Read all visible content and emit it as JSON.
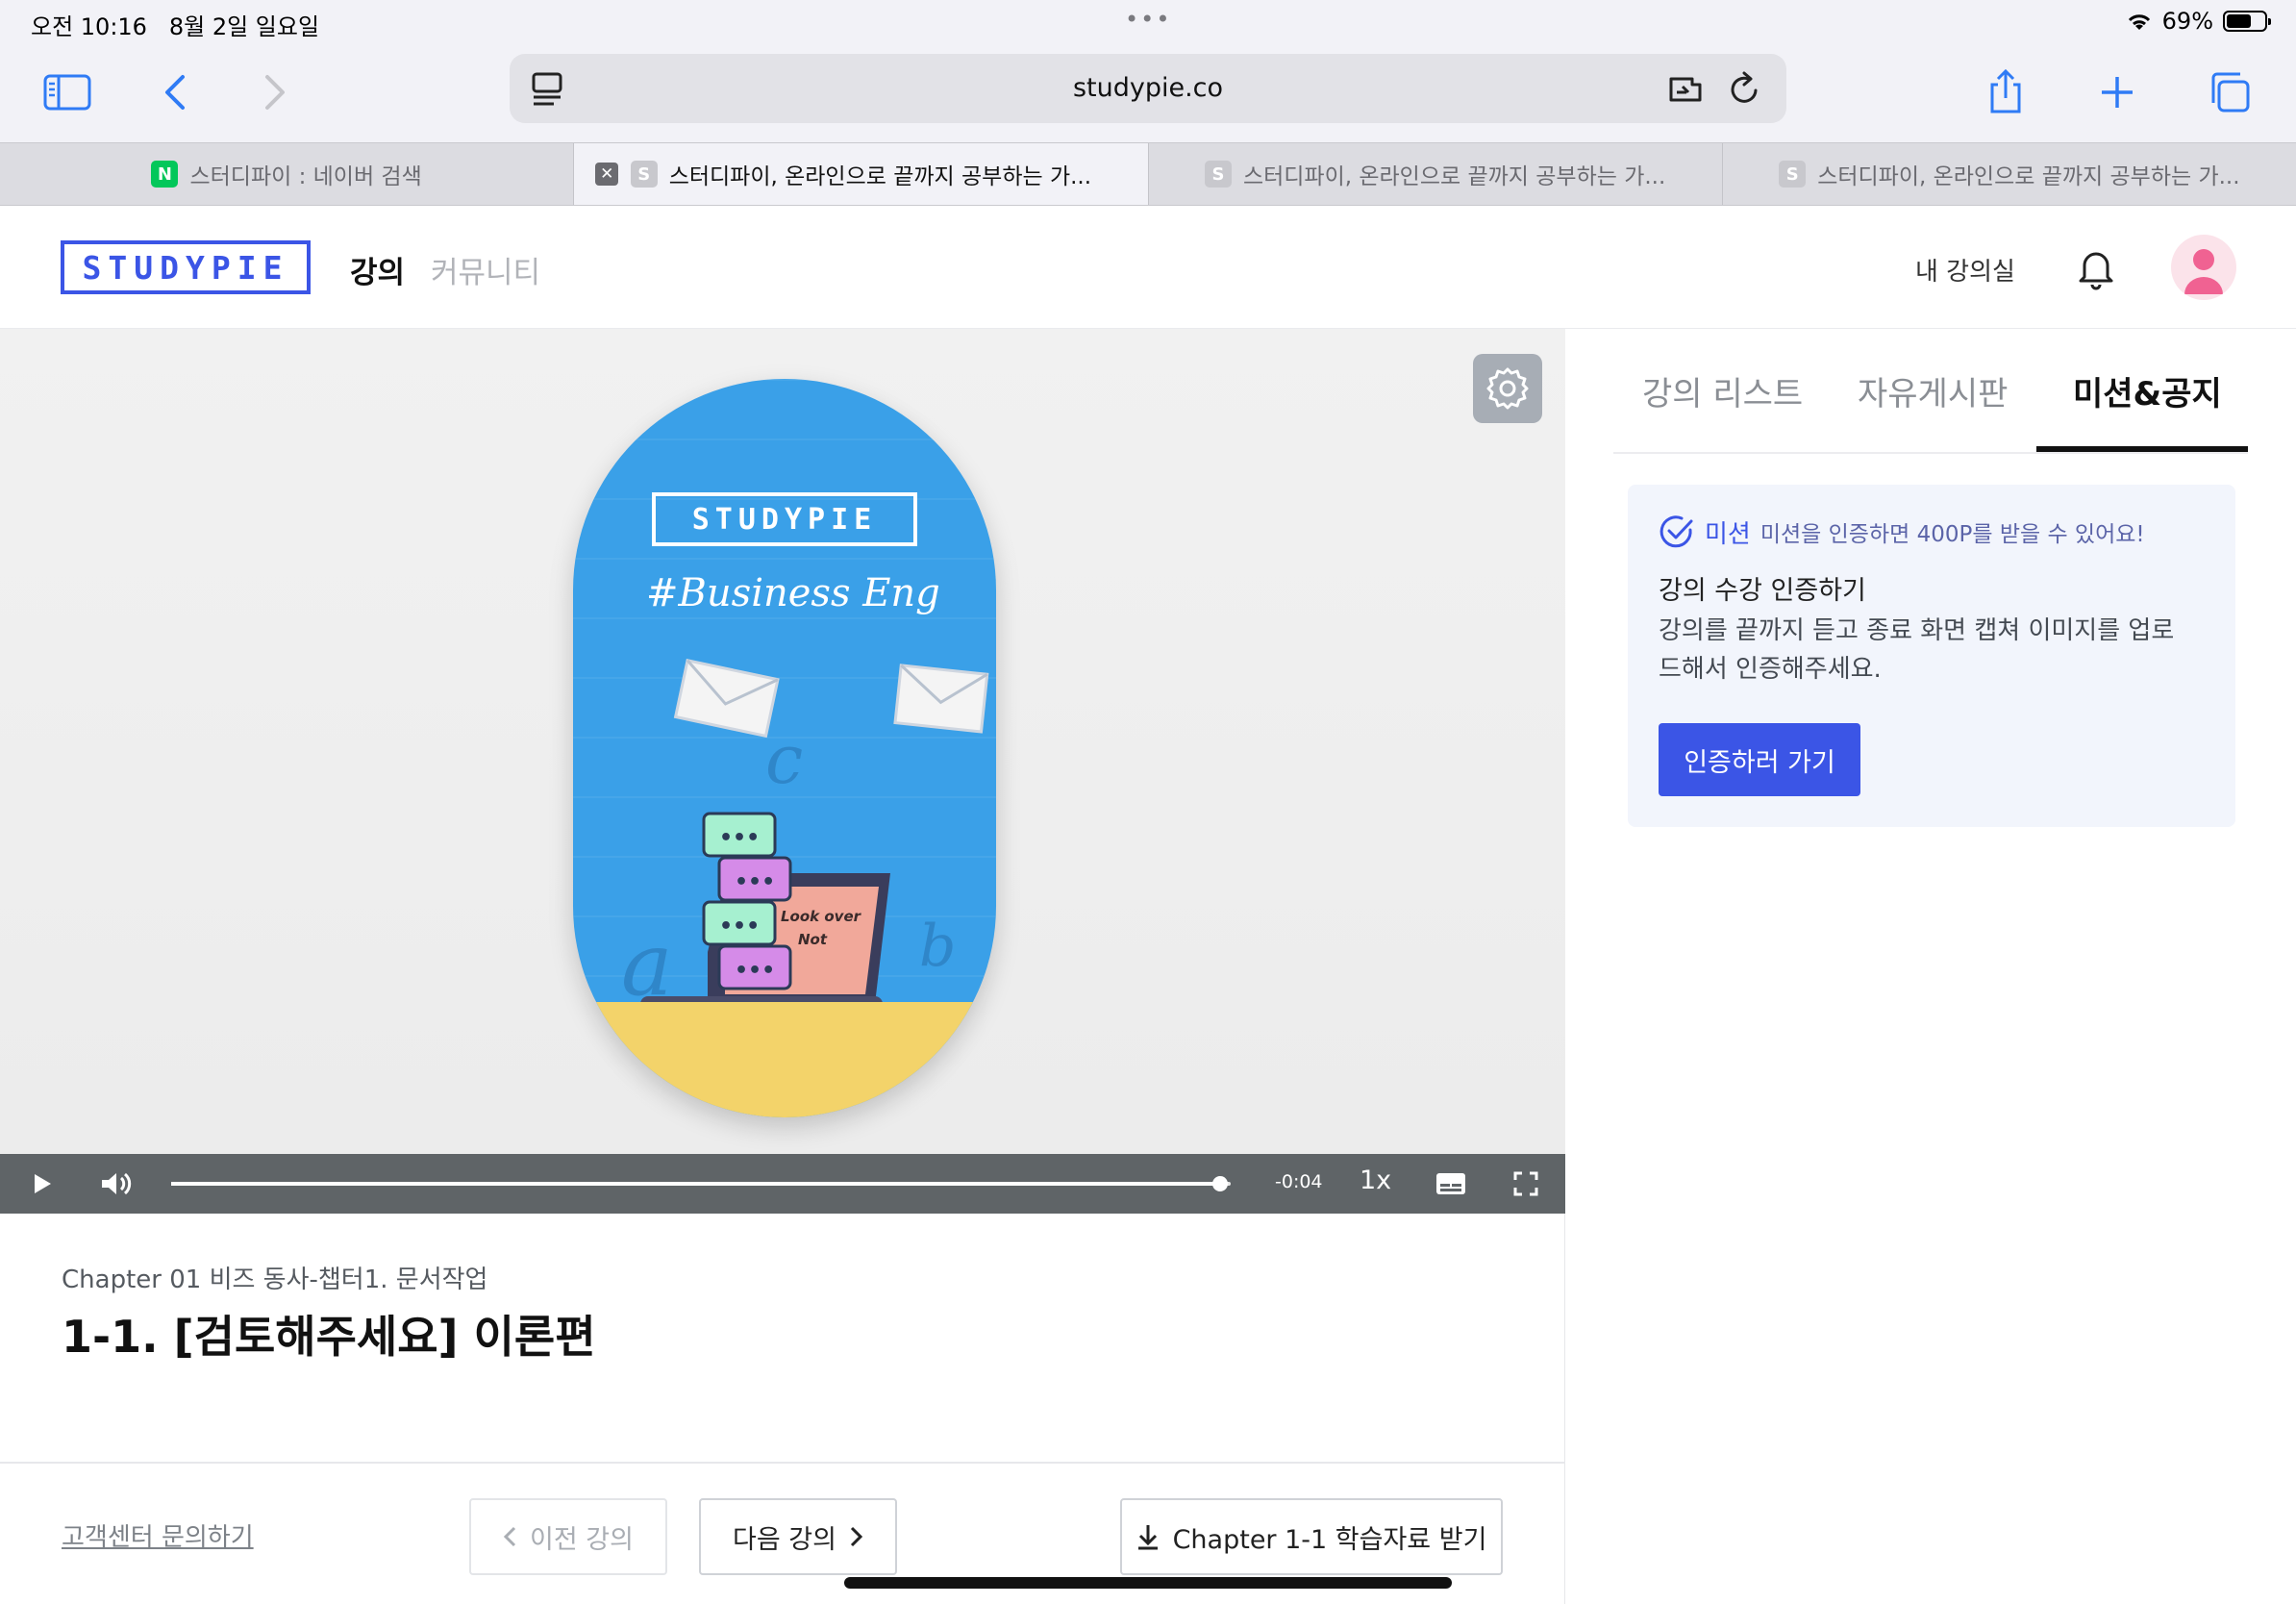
{
  "status_bar": {
    "time_date": "오전 10:16   8월 2일 일요일",
    "battery_percent": "69%",
    "battery_level": 0.69
  },
  "browser": {
    "url": "studypie.co",
    "tabs": [
      {
        "title": "스터디파이 : 네이버 검색",
        "favicon": "N",
        "favicon_color": "#03c75a",
        "active": false
      },
      {
        "title": "스터디파이, 온라인으로 끝까지 공부하는 가...",
        "favicon": "S",
        "favicon_color": "#c8c8cd",
        "active": true
      },
      {
        "title": "스터디파이, 온라인으로 끝까지 공부하는 가...",
        "favicon": "S",
        "favicon_color": "#c8c8cd",
        "active": false
      },
      {
        "title": "스터디파이, 온라인으로 끝까지 공부하는 가...",
        "favicon": "S",
        "favicon_color": "#c8c8cd",
        "active": false
      }
    ],
    "icons": [
      "sidebar-icon",
      "back-icon",
      "forward-icon",
      "reader-icon",
      "extension-icon",
      "reload-icon",
      "share-icon",
      "new-tab-icon",
      "tabs-overview-icon"
    ]
  },
  "header": {
    "logo": "STUDYPIE",
    "nav": {
      "lecture": "강의",
      "community": "커뮤니티"
    },
    "my_room": "내 강의실"
  },
  "video": {
    "thumbnail_logo": "STUDYPIE",
    "thumbnail_text": "#Business Eng",
    "time_remaining": "-0:04",
    "speed": "1x",
    "progress": 0.99
  },
  "lecture": {
    "chapter": "Chapter 01 비즈 동사-챕터1. 문서작업",
    "title": "1-1. [검토해주세요] 이론편"
  },
  "footer": {
    "cs_link": "고객센터 문의하기",
    "prev": "이전 강의",
    "next": "다음 강의",
    "download": "Chapter 1-1 학습자료 받기"
  },
  "sidebar": {
    "tabs": [
      "강의 리스트",
      "자유게시판",
      "미션&공지"
    ],
    "active_tab": "미션&공지",
    "mission": {
      "tag": "미션",
      "note": "미션을 인증하면 400P를 받을 수 있어요!",
      "title": "강의 수강 인증하기",
      "desc": "강의를 끝까지 듣고 종료 화면 캡쳐 이미지를 업로드해서 인증해주세요.",
      "button": "인증하러 가기"
    }
  },
  "colors": {
    "accent": "#3b55e6",
    "control_bar": "#5f6467",
    "mission_bg": "#f2f5fc"
  }
}
